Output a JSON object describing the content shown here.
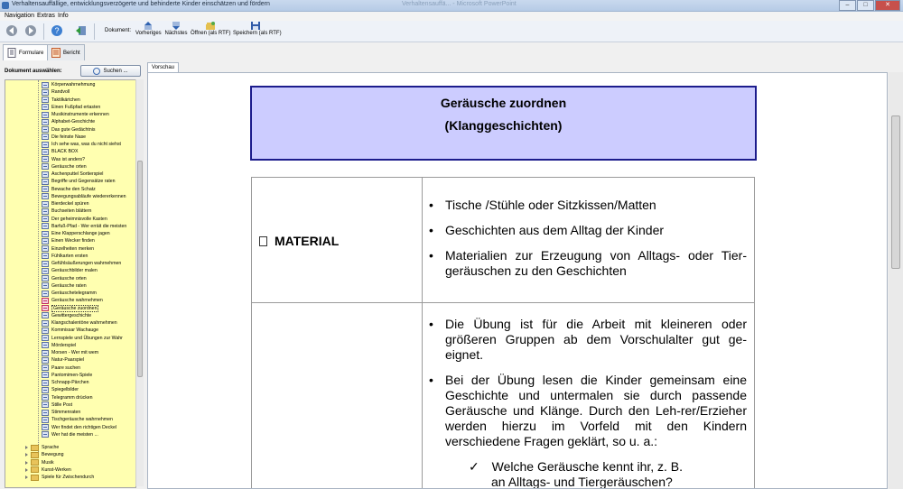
{
  "window": {
    "title": "Verhaltensauffällige, entwicklungsverzögerte und behinderte Kinder einschätzen und fördern",
    "ghost_title": "Verhaltensauffä... - Microsoft PowerPoint"
  },
  "menu": [
    "Navigation",
    "Extras",
    "Info"
  ],
  "toolbar": {
    "doc_label": "Dokument:",
    "buttons": [
      "Vorheriges",
      "Nächstes",
      "Öffnen (als RTF)",
      "Speichern (als RTF)"
    ]
  },
  "tabs": [
    "Formulare",
    "Bericht"
  ],
  "left": {
    "heading": "Dokument auswählen:",
    "search_label": "Suchen ..."
  },
  "tree": {
    "items": [
      "Körperwahrnehmung",
      "Randvoll",
      "Taktilkärtchen",
      "Einen Fußpfad ertasten",
      "Musikinstrumente erkennen",
      "Alphabet-Geschichte",
      "Das gute Gedächtnis",
      "Die feinste Nase",
      "Ich sehe was, was du nicht siehst",
      "BLACK BOX",
      "Was ist anders?",
      "Geräusche orten",
      "Aschenputtel Sortierspiel",
      "Begriffe und Gegensätze raten",
      "Bewache den Schatz",
      "Bewegungsabläufe wiedererkennen",
      "Bierdeckel spüren",
      "Buchseiten blättern",
      "Der geheimnisvolle Kasten",
      "Barfuß-Pfad - Wer erräit die meisten",
      "Eine Klapperschlange jagen",
      "Einen Wecker finden",
      "Einzelheiten merken",
      "Fühlkarten ersten",
      "Gefühlsäußerungen wahrnehmen",
      "Geräuschbilder malen",
      "Geräusche orten",
      "Geräusche raten",
      "Geräuschetelegramm",
      "Geräusche wahrnehmen",
      "Geräusche zuordnen",
      "Gewittergeschichte",
      "Klangschalentöne wahrnehmen",
      "Kommissar Wachauge",
      "Lernspiele und Übungen zur Wahr",
      "Mörderspiel",
      "Morsen - Wer mit wem",
      "Natur-Paarspiel",
      "Paare suchen",
      "Pantomimen-Spiele",
      "Schnapp-Pärchen",
      "Spiegelbilder",
      "Telegramm drücken",
      "Stille Post",
      "Stimmenraten",
      "Tischgeräusche wahrnehmen",
      "Wer findet den richtigen Deckel",
      "Wer hat die meisten ..."
    ],
    "folders": [
      "Sprache",
      "Bewegung",
      "Musik",
      "Kunst-Werken",
      "Spiele für Zwischendurch"
    ]
  },
  "preview": {
    "tab": "Vorschau",
    "heading1": "Geräusche zuordnen",
    "heading2": "(Klanggeschichten)",
    "material_label": "MATERIAL",
    "material_items": [
      "Tische /Stühle oder Sitzkissen/Matten",
      "Geschichten aus dem Alltag der Kinder",
      "Materialien zur Erzeugung von Alltags- oder Tier-geräuschen zu den Geschichten"
    ],
    "para1": "Die Übung ist für die Arbeit mit kleineren oder größeren Gruppen ab dem Vorschulalter gut ge-eignet.",
    "para2": "Bei der Übung lesen die Kinder gemeinsam eine Geschichte und untermalen sie durch passende Geräusche und Klänge. Durch den Leh-rer/Erzieher werden hierzu im Vorfeld mit den Kindern verschiedene Fragen geklärt, so u. a.:",
    "check1": "Welche Geräusche kennt ihr, z. B.",
    "check2": "an Alltags- und Tiergeräuschen?"
  },
  "colors": {
    "header_fill": "#ccccff",
    "header_border": "#1c1c8c",
    "tree_bg": "#ffffb0"
  },
  "icons": [
    "back-icon",
    "forward-icon",
    "help-icon",
    "exit-icon",
    "previous-doc-icon",
    "next-doc-icon",
    "open-rtf-icon",
    "save-rtf-icon"
  ]
}
